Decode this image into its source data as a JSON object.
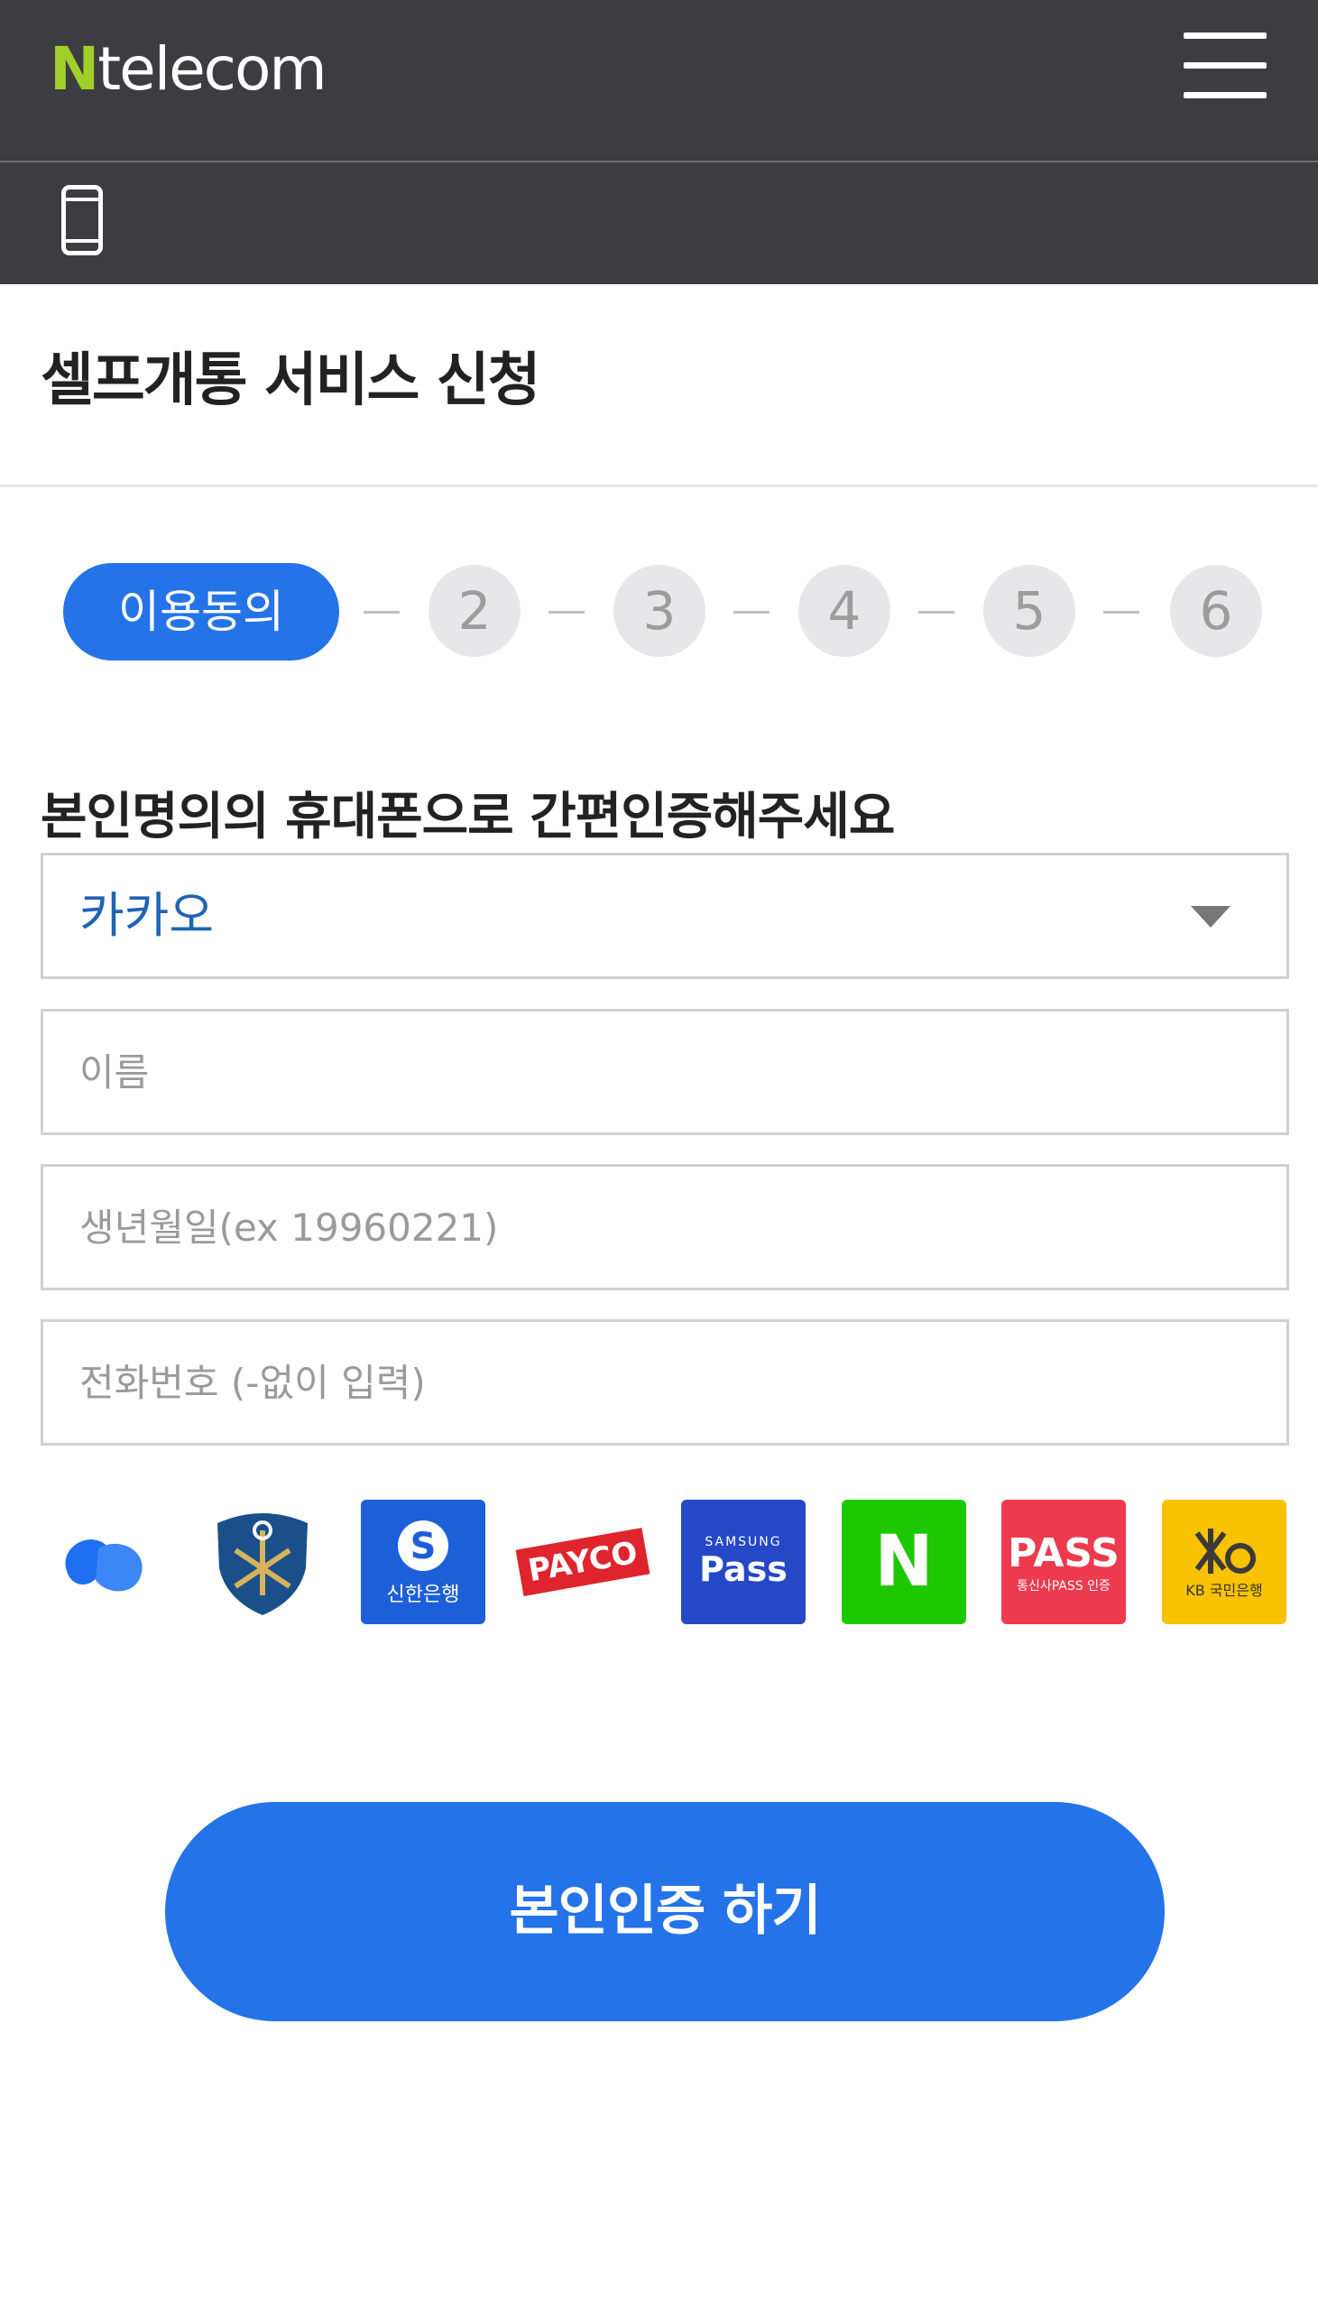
{
  "header": {
    "logo_n": "N",
    "logo_rest": "telecom",
    "brand_color": "#9fd12a",
    "background_color": "#3c3c41",
    "menu_icon": "hamburger-menu-icon",
    "sub_icon": "mobile-phone-icon"
  },
  "page": {
    "title": "셀프개통 서비스 신청"
  },
  "stepper": {
    "active_label": "이용동의",
    "steps": [
      "2",
      "3",
      "4",
      "5",
      "6"
    ],
    "active_color": "#2473e9"
  },
  "form": {
    "heading": "본인명의의 휴대폰으로 간편인증해주세요",
    "auth_method_selected": "카카오",
    "name_placeholder": "이름",
    "birth_placeholder": "생년월일(ex 19960221)",
    "phone_placeholder": "전화번호 (-없이 입력)"
  },
  "providers": [
    {
      "name": "toss-icon",
      "color": "#1e6ff0"
    },
    {
      "name": "shield-logo-icon",
      "color": "#1a4f8a"
    },
    {
      "name": "shinhan-bank-icon",
      "label": "신한은행",
      "color": "#1c5fd9"
    },
    {
      "name": "payco-icon",
      "label": "PAYCO",
      "color": "#e0242e"
    },
    {
      "name": "samsung-pass-icon",
      "label_top": "SAMSUNG",
      "label": "Pass",
      "color": "#2548c7"
    },
    {
      "name": "naver-icon",
      "label": "N",
      "color": "#1ec800"
    },
    {
      "name": "pass-icon",
      "label": "PASS",
      "label_sub": "통신사PASS 인증",
      "color": "#ee3a4e"
    },
    {
      "name": "kb-bank-icon",
      "label": "KB 국민은행",
      "color": "#f8c200"
    }
  ],
  "submit": {
    "label": "본인인증 하기"
  }
}
